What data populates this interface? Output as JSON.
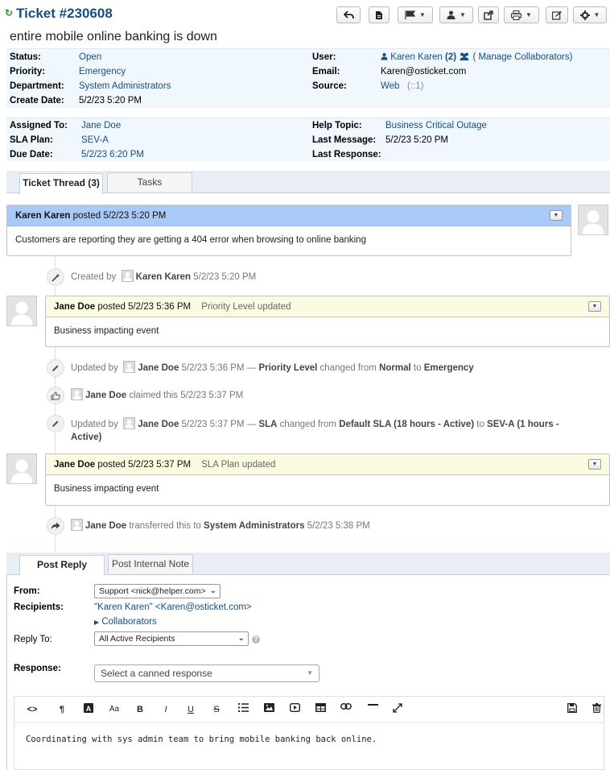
{
  "header": {
    "ticket_title": "Ticket #230608",
    "subject": "entire mobile online banking is down"
  },
  "info": {
    "status_label": "Status:",
    "status_value": "Open",
    "priority_label": "Priority:",
    "priority_value": "Emergency",
    "department_label": "Department:",
    "department_value": "System Administrators",
    "create_label": "Create Date:",
    "create_value": "5/2/23 5:20 PM",
    "user_label": "User:",
    "user_value": "Karen Karen",
    "user_count": "(2)",
    "manage_collab": "( Manage Collaborators)",
    "email_label": "Email:",
    "email_value": "Karen@osticket.com",
    "source_label": "Source:",
    "source_value": "Web",
    "source_extra": "(::1)",
    "assigned_label": "Assigned To:",
    "assigned_value": "Jane Doe",
    "sla_label": "SLA Plan:",
    "sla_value": "SEV-A",
    "due_label": "Due Date:",
    "due_value": "5/2/23 6:20 PM",
    "helptopic_label": "Help Topic:",
    "helptopic_value": "Business Critical Outage",
    "lastmsg_label": "Last Message:",
    "lastmsg_value": "5/2/23 5:20 PM",
    "lastresp_label": "Last Response:",
    "lastresp_value": ""
  },
  "tabs": {
    "thread": "Ticket Thread (3)",
    "tasks": "Tasks"
  },
  "thread": {
    "entry1": {
      "author": "Karen Karen",
      "posted": "posted 5/2/23 5:20 PM",
      "body": "Customers are reporting they are getting a 404 error when browsing to online banking"
    },
    "event1": {
      "prefix": "Created by",
      "who": "Karen Karen",
      "when": "5/2/23 5:20 PM"
    },
    "entry2": {
      "author": "Jane Doe",
      "posted": "posted 5/2/23 5:36 PM",
      "meta": "Priority Level updated",
      "body": "Business impacting event"
    },
    "event2": {
      "prefix": "Updated by",
      "who": "Jane Doe",
      "when": "5/2/23 5:36 PM —",
      "field": "Priority Level",
      "mid": "changed from",
      "from": "Normal",
      "to_word": "to",
      "to": "Emergency"
    },
    "event3": {
      "who": "Jane Doe",
      "rest": "claimed this 5/2/23 5:37 PM"
    },
    "event4": {
      "prefix": "Updated by",
      "who": "Jane Doe",
      "when": "5/2/23 5:37 PM —",
      "field": "SLA",
      "mid": "changed from",
      "from": "Default SLA (18 hours - Active)",
      "to_word": "to",
      "to": "SEV-A (1 hours -",
      "to_cont": "Active)"
    },
    "entry3": {
      "author": "Jane Doe",
      "posted": "posted 5/2/23 5:37 PM",
      "meta": "SLA Plan updated",
      "body": "Business impacting event"
    },
    "event5": {
      "who": "Jane Doe",
      "mid": "transferred this to",
      "dept": "System Administrators",
      "when": "5/2/23 5:38 PM"
    }
  },
  "reply_tabs": {
    "post_reply": "Post Reply",
    "internal_note": "Post Internal Note"
  },
  "reply": {
    "from_label": "From:",
    "from_value": "Support <nick@helper.com>",
    "recipients_label": "Recipients:",
    "recipients_value": "\"Karen Karen\" <Karen@osticket.com>",
    "collaborators": "Collaborators",
    "replyto_label": "Reply To:",
    "replyto_value": "All Active Recipients",
    "response_label": "Response:",
    "canned_placeholder": "Select a canned response",
    "editor_text": "Coordinating with sys admin team to bring mobile banking back online."
  },
  "colors": {
    "link": "#184e81",
    "info_bg": "#f0f7fd",
    "customer_header": "#a9c9f7",
    "staff_header": "#fbfbe2",
    "refresh_green": "#2e8b2e"
  }
}
